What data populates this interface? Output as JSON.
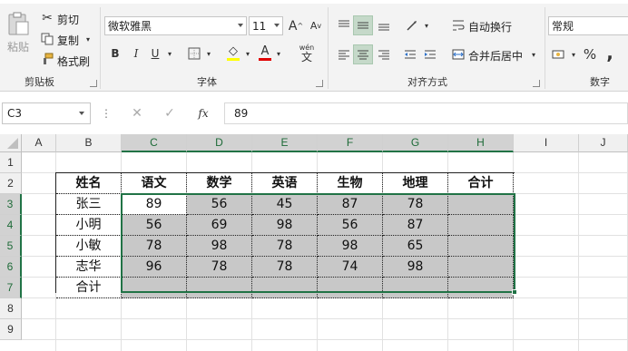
{
  "ribbon": {
    "clipboard": {
      "paste": "粘贴",
      "cut": "剪切",
      "copy": "复制",
      "format_painter": "格式刷",
      "group": "剪贴板"
    },
    "font": {
      "name": "微软雅黑",
      "size": "11",
      "bold": "B",
      "italic": "I",
      "underline": "U",
      "grow": "A",
      "shrink": "A",
      "font_color": "A",
      "phonetic": "wén",
      "group": "字体"
    },
    "alignment": {
      "wrap": "自动换行",
      "merge": "合并后居中",
      "group": "对齐方式"
    },
    "number": {
      "format": "常规",
      "percent": "%",
      "comma": ",",
      "group": "数字"
    }
  },
  "formula_bar": {
    "name_box": "C3",
    "fx": "fx",
    "value": "89"
  },
  "columns": [
    "A",
    "B",
    "C",
    "D",
    "E",
    "F",
    "G",
    "H",
    "I",
    "J"
  ],
  "rows": [
    "1",
    "2",
    "3",
    "4",
    "5",
    "6",
    "7",
    "8",
    "9"
  ],
  "table": {
    "headers": [
      "姓名",
      "语文",
      "数学",
      "英语",
      "生物",
      "地理",
      "合计"
    ],
    "data": [
      [
        "张三",
        "89",
        "56",
        "45",
        "87",
        "78",
        ""
      ],
      [
        "小明",
        "56",
        "69",
        "98",
        "56",
        "87",
        ""
      ],
      [
        "小敏",
        "78",
        "98",
        "78",
        "98",
        "65",
        ""
      ],
      [
        "志华",
        "96",
        "78",
        "78",
        "74",
        "98",
        ""
      ],
      [
        "合计",
        "",
        "",
        "",
        "",
        "",
        ""
      ]
    ]
  }
}
